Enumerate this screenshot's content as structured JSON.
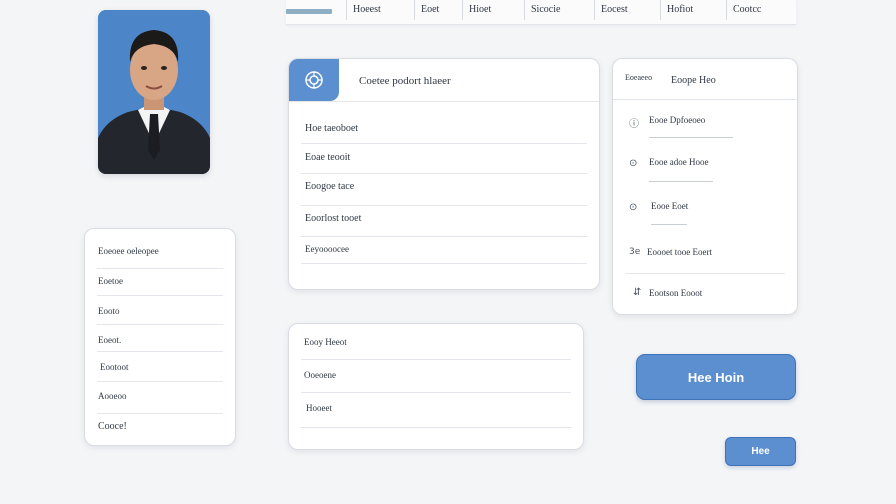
{
  "nav": {
    "items": [
      "Hoeest",
      "Eoet",
      "Hioet",
      "Sicocie",
      "Eocest",
      "Hofiot",
      "Cootcc"
    ]
  },
  "main_card": {
    "title": "Coetee podort hlaeer",
    "icon": "badge-icon",
    "rows": [
      "Hoe taeoboet",
      "Eoae teooit",
      "Eoogoe tace",
      "Eoorlost tooet",
      "Eeyoooocee"
    ]
  },
  "side_panel": {
    "header_left": "Eoeaeeo",
    "header_right": "Eoope Heo",
    "items": [
      {
        "icon": "info-icon",
        "label": "Eooe Dpfoeoeo"
      },
      {
        "icon": "circle-icon",
        "label": "Eooe adoe Hooe"
      },
      {
        "icon": "circle-icon",
        "label": "Eooe Eoet"
      },
      {
        "icon": "arrow-icon",
        "label": "Eoooet tooe Eoert"
      },
      {
        "icon": "link-icon",
        "label": "Eootson Eooot"
      }
    ],
    "item_prefix_4": "3e"
  },
  "left_list": {
    "items": [
      "Eoeoee oeleopee",
      "Eoetoe",
      "Eooto",
      "Eoeot.",
      "Eootoot",
      "Aooeoo",
      "Cooce!"
    ]
  },
  "bottom_card": {
    "rows": [
      "Eooy Heeot",
      "Ooeoene",
      "Hooeet"
    ]
  },
  "buttons": {
    "primary": "Hee Hoin",
    "small": "Hee"
  },
  "colors": {
    "accent": "#5b8fd0",
    "nav_accent": "#8eaec4",
    "background": "#f4f5f7"
  }
}
